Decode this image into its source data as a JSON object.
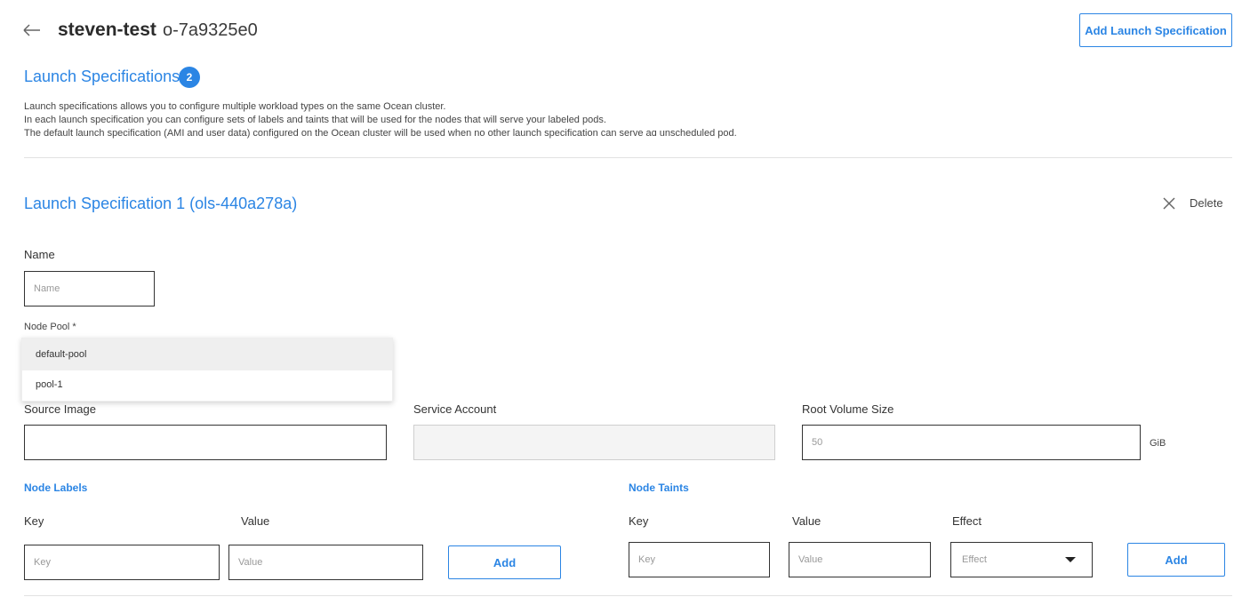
{
  "header": {
    "cluster_name": "steven-test",
    "cluster_id": "o-7a9325e0",
    "add_spec_label": "Add Launch Specification"
  },
  "section": {
    "title": "Launch Specifications",
    "count": "2",
    "description": [
      "Launch specifications allows you to configure multiple workload types on the same Ocean cluster.",
      "In each launch specification you can configure sets of labels and taints that will be used for the nodes that will serve your labeled pods.",
      "The default launch specification (AMI and user data) configured on the Ocean cluster will be used when no other launch specification can serve aɑ unscheduled pod."
    ]
  },
  "spec": {
    "title": "Launch Specification 1 (ols-440a278a)",
    "delete_label": "Delete",
    "name_label": "Name",
    "name_placeholder": "Name",
    "node_pool_label": "Node Pool *",
    "node_pool_options": [
      "default-pool",
      "pool-1"
    ],
    "node_pool_selected": "default-pool",
    "source_image_label": "Source Image",
    "service_account_label": "Service Account",
    "root_volume_label": "Root Volume Size",
    "root_volume_placeholder": "50",
    "root_volume_unit": "GiB"
  },
  "node_labels": {
    "title": "Node Labels",
    "key_label": "Key",
    "value_label": "Value",
    "key_placeholder": "Key",
    "value_placeholder": "Value",
    "add_label": "Add"
  },
  "node_taints": {
    "title": "Node Taints",
    "key_label": "Key",
    "value_label": "Value",
    "effect_label": "Effect",
    "key_placeholder": "Key",
    "value_placeholder": "Value",
    "effect_placeholder": "Effect",
    "add_label": "Add"
  },
  "colors": {
    "accent": "#2b85e4"
  }
}
